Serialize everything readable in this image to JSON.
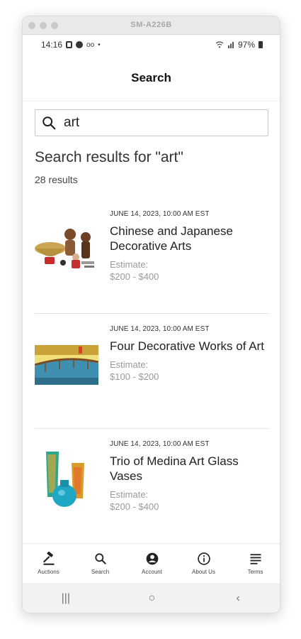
{
  "window": {
    "title": "SM-A226B"
  },
  "status_bar": {
    "time": "14:16",
    "dot": "•",
    "voicemail": "oo",
    "battery": "97%"
  },
  "header": {
    "title": "Search"
  },
  "search": {
    "value": "art",
    "heading": "Search results for \"art\"",
    "count": "28 results"
  },
  "results": [
    {
      "date": "JUNE 14, 2023, 10:00 AM EST",
      "title": "Chinese and Japanese Decorative Arts",
      "estimate_label": "Estimate:",
      "estimate": "$200 - $400"
    },
    {
      "date": "JUNE 14, 2023, 10:00 AM EST",
      "title": "Four Decorative Works of Art",
      "estimate_label": "Estimate:",
      "estimate": "$100 - $200"
    },
    {
      "date": "JUNE 14, 2023, 10:00 AM EST",
      "title": "Trio of Medina Art Glass Vases",
      "estimate_label": "Estimate:",
      "estimate": "$200 - $400"
    }
  ],
  "bottom_nav": [
    {
      "label": "Auctions",
      "icon": "gavel-icon"
    },
    {
      "label": "Search",
      "icon": "search-icon"
    },
    {
      "label": "Account",
      "icon": "account-icon"
    },
    {
      "label": "About Us",
      "icon": "info-icon"
    },
    {
      "label": "Terms",
      "icon": "list-icon"
    }
  ],
  "system_nav": {
    "recents": "|||",
    "home": "○",
    "back": "‹"
  }
}
